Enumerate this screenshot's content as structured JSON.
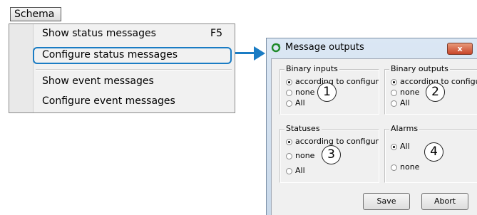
{
  "menubar": {
    "label": "Schema"
  },
  "menu": {
    "items": [
      {
        "label": "Show status messages",
        "shortcut": "F5"
      },
      {
        "label": "Configure status messages",
        "shortcut": ""
      },
      {
        "label": "Show event messages",
        "shortcut": ""
      },
      {
        "label": "Configure event messages",
        "shortcut": ""
      }
    ]
  },
  "dialog": {
    "title": "Message outputs",
    "close_label": "x",
    "groups": {
      "binary_inputs": {
        "label": "Binary inputs",
        "options": [
          "according to configur",
          "none",
          "All"
        ],
        "selected": 0,
        "badge": "1"
      },
      "binary_outputs": {
        "label": "Binary outputs",
        "options": [
          "according to configur",
          "none",
          "All"
        ],
        "selected": 0,
        "badge": "2"
      },
      "statuses": {
        "label": "Statuses",
        "options": [
          "according to configur",
          "none",
          "All"
        ],
        "selected": 0,
        "badge": "3"
      },
      "alarms": {
        "label": "Alarms",
        "options": [
          "All",
          "none"
        ],
        "selected": 0,
        "badge": "4"
      }
    },
    "buttons": {
      "save": "Save",
      "abort": "Abort"
    }
  },
  "colors": {
    "accent": "#1a7cc4",
    "close": "#c8452a"
  }
}
